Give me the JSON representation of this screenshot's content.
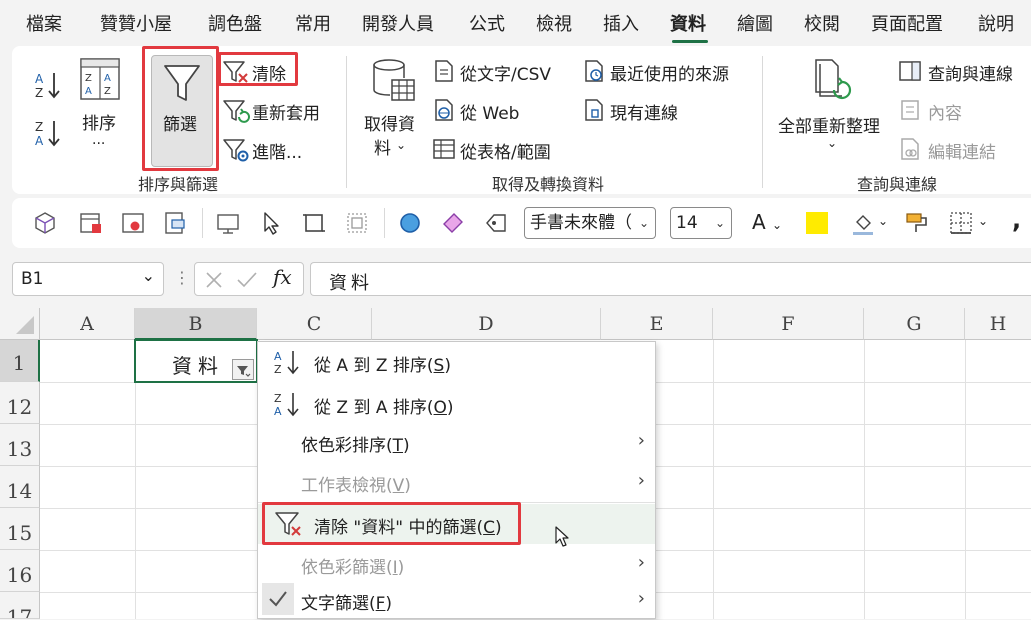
{
  "tabs": [
    {
      "label": "檔案"
    },
    {
      "label": "贊贊小屋"
    },
    {
      "label": "調色盤"
    },
    {
      "label": "常用"
    },
    {
      "label": "開發人員"
    },
    {
      "label": "公式"
    },
    {
      "label": "檢視"
    },
    {
      "label": "插入"
    },
    {
      "label": "資料"
    },
    {
      "label": "繪圖"
    },
    {
      "label": "校閱"
    },
    {
      "label": "頁面配置"
    },
    {
      "label": "說明"
    }
  ],
  "ribbon": {
    "sort_label": "排序",
    "sort_ellipsis": "...",
    "filter_label": "篩選",
    "clear_label": "清除",
    "reapply_label": "重新套用",
    "advanced_label": "進階...",
    "group_sort_filter": "排序與篩選",
    "get_data_line1": "取得資",
    "get_data_line2": "料",
    "from_text_csv": "從文字/CSV",
    "from_web": "從 Web",
    "from_table": "從表格/範圍",
    "recent_sources": "最近使用的來源",
    "existing_connections": "現有連線",
    "group_get_transform": "取得及轉換資料",
    "refresh_all": "全部重新整理",
    "queries_connections": "查詢與連線",
    "properties": "內容",
    "edit_links": "編輯連結",
    "group_queries": "查詢與連線"
  },
  "toolbar2": {
    "font_name": "手書未來體（",
    "font_size": "14",
    "font_letter": "A",
    "highlight_color": "#ffeb00"
  },
  "formula_bar": {
    "name_box": "B1",
    "fx": "fx",
    "content": "資料"
  },
  "grid": {
    "columns": [
      "A",
      "B",
      "C",
      "D",
      "E",
      "F",
      "G",
      "H"
    ],
    "rows": [
      "1",
      "12",
      "13",
      "14",
      "15",
      "16",
      "17"
    ],
    "cell_b1": "資料"
  },
  "menu": {
    "sort_az": {
      "text": "從 A 到 Z 排序(",
      "key": "S",
      "end": ")"
    },
    "sort_za": {
      "text": "從 Z 到 A 排序(",
      "key": "O",
      "end": ")"
    },
    "sort_color": {
      "text": "依色彩排序(",
      "key": "T",
      "end": ")"
    },
    "sheet_view": {
      "text": "工作表檢視(",
      "key": "V",
      "end": ")"
    },
    "clear_filter": {
      "text": "清除 \"資料\" 中的篩選(",
      "key": "C",
      "end": ")"
    },
    "filter_color": {
      "text": "依色彩篩選(",
      "key": "I",
      "end": ")"
    },
    "text_filter": {
      "text": "文字篩選(",
      "key": "F",
      "end": ")"
    }
  },
  "colors": {
    "accent": "#1e7145",
    "highlight_box": "#e2393f",
    "menu_hover": "#edf3ee"
  }
}
